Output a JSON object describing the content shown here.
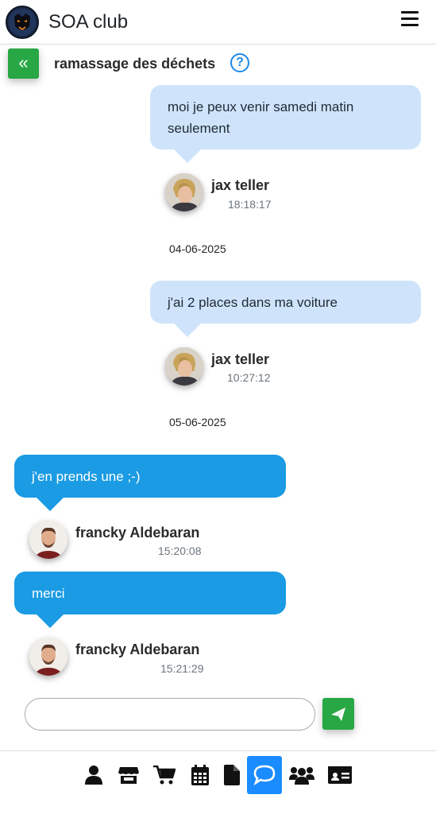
{
  "header": {
    "app_title": "SOA club",
    "logo_icon": "club-logo-icon",
    "menu_icon": "hamburger-menu-icon"
  },
  "topic": {
    "back_icon": "double-chevron-left-icon",
    "back_glyph": "«",
    "title": "ramassage des déchets",
    "help_glyph": "?"
  },
  "messages": [
    {
      "text_line1": "moi je peux venir samedi matin",
      "text_line2": "seulement",
      "author": "jax teller",
      "time": "18:18:17",
      "own": true
    },
    {
      "date_separator": "04-06-2025"
    },
    {
      "text": "j'ai 2 places dans ma voiture",
      "author": "jax teller",
      "time": "10:27:12",
      "own": true
    },
    {
      "date_separator": "05-06-2025"
    },
    {
      "text": "j'en prends une ;-)",
      "author": "francky Aldebaran",
      "time": "15:20:08",
      "own": false
    },
    {
      "text": "merci",
      "author": "francky Aldebaran",
      "time": "15:21:29",
      "own": false
    }
  ],
  "composer": {
    "placeholder": "",
    "value": "",
    "send_icon": "paper-plane-icon"
  },
  "bottom_nav": {
    "items": [
      {
        "icon": "user-icon",
        "active": false
      },
      {
        "icon": "store-icon",
        "active": false
      },
      {
        "icon": "shopping-cart-icon",
        "active": false
      },
      {
        "icon": "calendar-icon",
        "active": false
      },
      {
        "icon": "file-icon",
        "active": false
      },
      {
        "icon": "chat-bubble-icon",
        "active": true
      },
      {
        "icon": "users-icon",
        "active": false
      },
      {
        "icon": "id-card-icon",
        "active": false
      }
    ]
  },
  "colors": {
    "own_bubble": "#cfe4fb",
    "other_bubble": "#1a9be3",
    "accent_green": "#28a745",
    "accent_blue": "#1a8cff"
  }
}
